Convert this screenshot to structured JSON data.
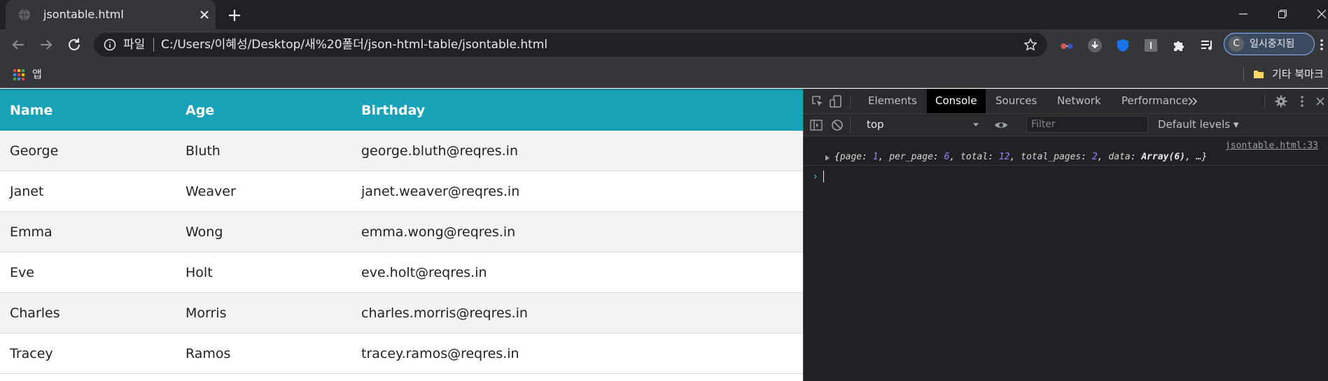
{
  "browser": {
    "tab": {
      "title": "jsontable.html"
    },
    "address": {
      "scheme": "파일",
      "url": "C:/Users/이혜성/Desktop/새%20폴더/json-html-table/jsontable.html"
    },
    "profile": {
      "initial": "C",
      "label": "일시중지됨"
    },
    "bookmarks": {
      "apps_label": "앱",
      "other_label": "기타 북마크"
    }
  },
  "table": {
    "columns": [
      "Name",
      "Age",
      "Birthday"
    ],
    "rows": [
      [
        "George",
        "Bluth",
        "george.bluth@reqres.in"
      ],
      [
        "Janet",
        "Weaver",
        "janet.weaver@reqres.in"
      ],
      [
        "Emma",
        "Wong",
        "emma.wong@reqres.in"
      ],
      [
        "Eve",
        "Holt",
        "eve.holt@reqres.in"
      ],
      [
        "Charles",
        "Morris",
        "charles.morris@reqres.in"
      ],
      [
        "Tracey",
        "Ramos",
        "tracey.ramos@reqres.in"
      ]
    ]
  },
  "devtools": {
    "tabs": [
      "Elements",
      "Console",
      "Sources",
      "Network",
      "Performance"
    ],
    "active_tab": "Console",
    "context": "top",
    "filter_placeholder": "Filter",
    "levels_label": "Default levels",
    "log": {
      "source": "jsontable.html:33",
      "entries": [
        {
          "key": "page",
          "value": "1",
          "kind": "number"
        },
        {
          "key": "per_page",
          "value": "6",
          "kind": "number"
        },
        {
          "key": "total",
          "value": "12",
          "kind": "number"
        },
        {
          "key": "total_pages",
          "value": "2",
          "kind": "number"
        },
        {
          "key": "data",
          "value": "Array(6)",
          "kind": "bold"
        }
      ],
      "tail": "…"
    }
  },
  "colors": {
    "accent": "#17a2b8",
    "chrome_dark": "#202124",
    "chrome_mid": "#35363a",
    "devtools_bg": "#202124"
  }
}
